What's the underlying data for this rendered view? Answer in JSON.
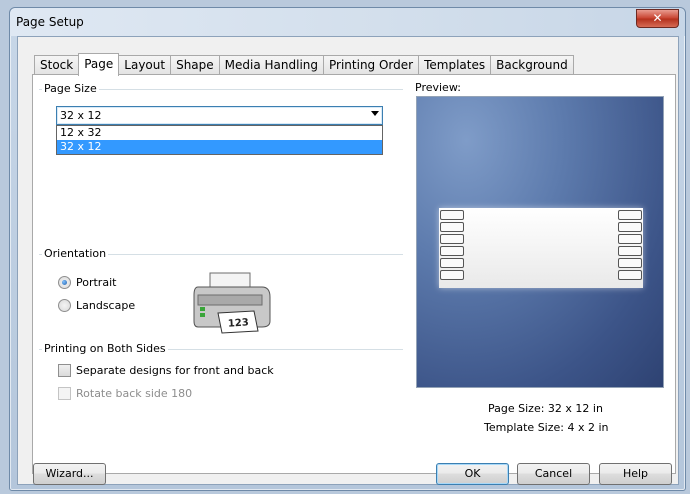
{
  "window": {
    "title": "Page Setup",
    "close_label": "✕"
  },
  "tabs": [
    {
      "label": "Stock"
    },
    {
      "label": "Page"
    },
    {
      "label": "Layout"
    },
    {
      "label": "Shape"
    },
    {
      "label": "Media Handling"
    },
    {
      "label": "Printing Order"
    },
    {
      "label": "Templates"
    },
    {
      "label": "Background"
    }
  ],
  "active_tab": "Page",
  "page_size": {
    "group_label": "Page Size",
    "selected": "32 x 12",
    "options": [
      "12 x 32",
      "32 x 12"
    ]
  },
  "orientation": {
    "group_label": "Orientation",
    "portrait_label": "Portrait",
    "landscape_label": "Landscape",
    "selected": "Portrait",
    "printer_label_text": "123"
  },
  "printing_both_sides": {
    "group_label": "Printing on Both Sides",
    "separate_label": "Separate designs for front and back",
    "rotate_label": "Rotate back side 180"
  },
  "preview": {
    "label": "Preview:",
    "page_size_label": "Page Size:",
    "page_size_value": "32 x 12 in",
    "template_size_label": "Template Size:",
    "template_size_value": "4 x 2 in"
  },
  "buttons": {
    "wizard": "Wizard...",
    "ok": "OK",
    "cancel": "Cancel",
    "help": "Help"
  },
  "colors": {
    "selection": "#3399ff",
    "preview_bg": "#4a6597",
    "close": "#c7402d"
  }
}
